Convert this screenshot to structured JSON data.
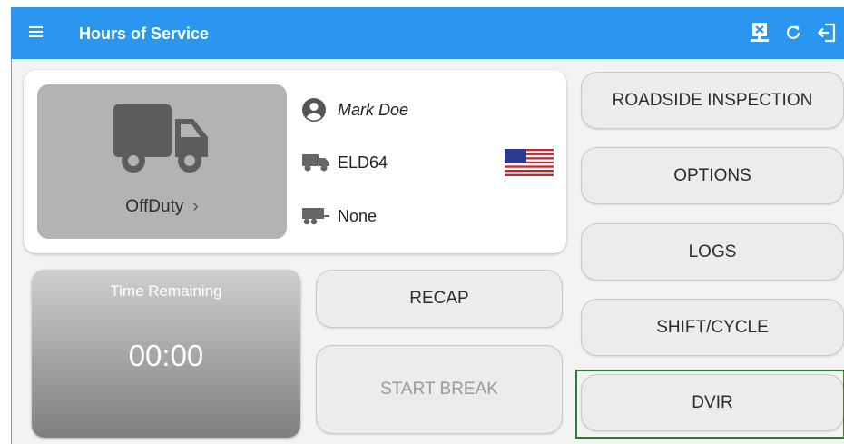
{
  "app": {
    "title": "Hours of Service",
    "accent": "#2a96f0"
  },
  "toolbar": {
    "menu_icon": "menu-icon",
    "actions": [
      "disconnect-eld-icon",
      "refresh-icon",
      "logout-icon"
    ]
  },
  "status": {
    "label": "OffDuty",
    "chevron": "›"
  },
  "driver": {
    "name": "Mark Doe"
  },
  "vehicle": {
    "name": "ELD64"
  },
  "trailer": {
    "name": "None"
  },
  "time_remaining": {
    "label": "Time Remaining",
    "value": "00:00"
  },
  "buttons": {
    "recap": "RECAP",
    "start_break": "START BREAK",
    "roadside": "ROADSIDE INSPECTION",
    "options": "OPTIONS",
    "logs": "LOGS",
    "shift_cycle": "SHIFT/CYCLE",
    "dvir": "DVIR"
  }
}
